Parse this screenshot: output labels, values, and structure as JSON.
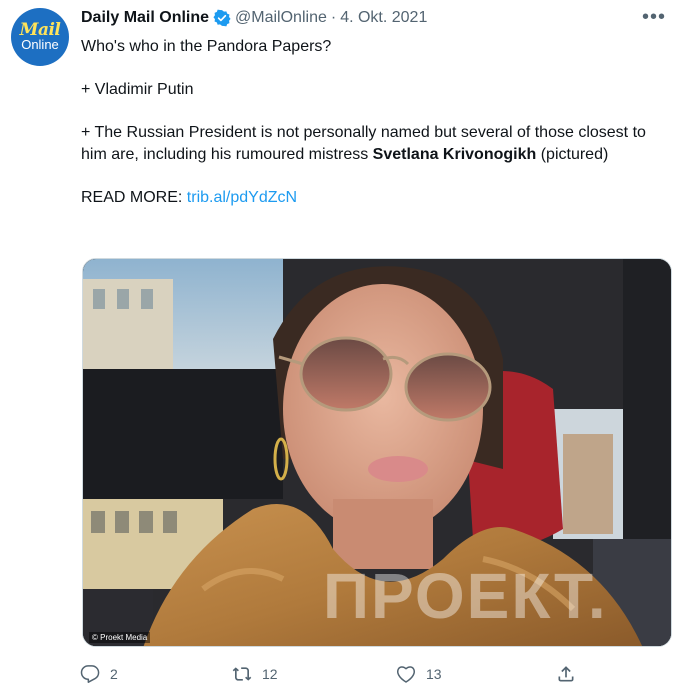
{
  "author": {
    "name": "Daily Mail Online",
    "handle": "@MailOnline",
    "separator": "·",
    "date": "4. Okt. 2021",
    "avatar_line1": "Mail",
    "avatar_line2": "Online"
  },
  "menu": {
    "more_label": "•••"
  },
  "tweet": {
    "line1": "Who's who in the Pandora Papers?",
    "line2": "+ Vladimir Putin",
    "line3_prefix": "+ The Russian President is not personally named but several of those closest to him are, including his rumoured mistress ",
    "line3_bold": "Svetlana Krivonogikh",
    "line3_suffix": " (pictured)",
    "read_more_label": "READ MORE: ",
    "read_more_link": "trib.al/pdYdZcN"
  },
  "media": {
    "credit": "© Proekt Media",
    "watermark": "ПРОЕКТ."
  },
  "stats": {
    "replies": "2",
    "retweets": "12",
    "likes": "13"
  },
  "colors": {
    "link": "#1d9bf0",
    "verified": "#1d9bf0",
    "avatar_bg": "#1d6fc2",
    "secondary_text": "#536471"
  }
}
